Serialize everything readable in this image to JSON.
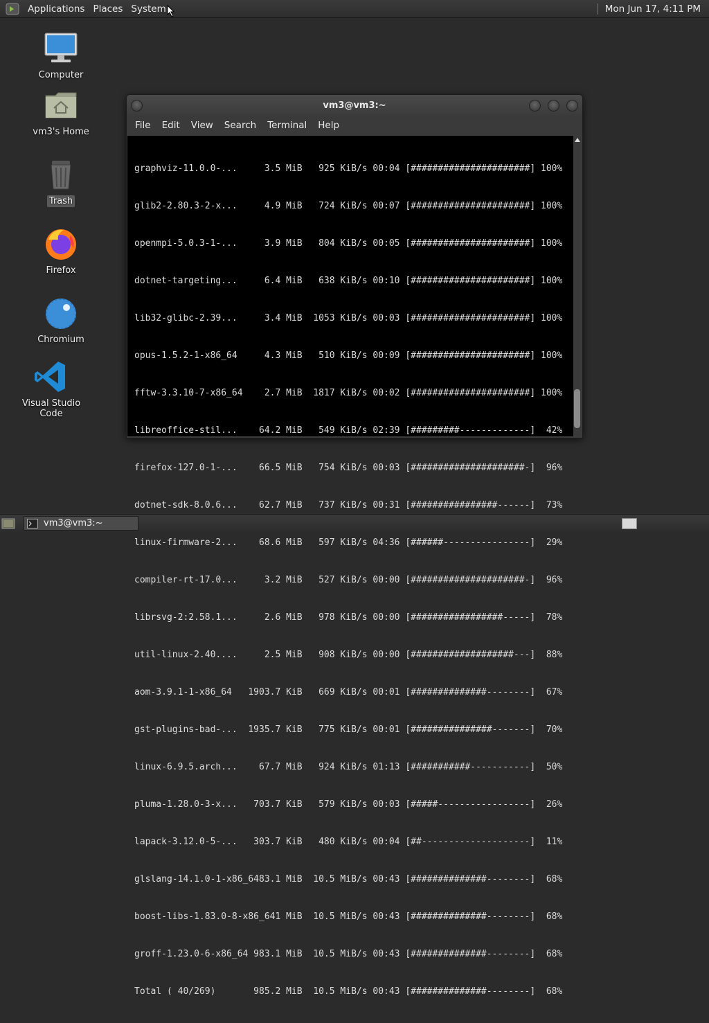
{
  "top_panel": {
    "menus": [
      "Applications",
      "Places",
      "System"
    ],
    "clock": "Mon Jun 17,  4:11 PM"
  },
  "desktop": {
    "icons": [
      {
        "label": "Computer",
        "icon": "computer-icon"
      },
      {
        "label": "vm3's Home",
        "icon": "home-folder-icon"
      },
      {
        "label": "Trash",
        "icon": "trash-icon"
      },
      {
        "label": "Firefox",
        "icon": "firefox-icon"
      },
      {
        "label": "Chromium",
        "icon": "chromium-icon"
      },
      {
        "label": "Visual Studio Code",
        "icon": "vscode-icon"
      }
    ]
  },
  "window": {
    "title": "vm3@vm3:~",
    "menu": [
      "File",
      "Edit",
      "View",
      "Search",
      "Terminal",
      "Help"
    ],
    "lines": [
      "graphviz-11.0.0-...     3.5 MiB   925 KiB/s 00:04 [######################] 100%",
      "glib2-2.80.3-2-x...     4.9 MiB   724 KiB/s 00:07 [######################] 100%",
      "openmpi-5.0.3-1-...     3.9 MiB   804 KiB/s 00:05 [######################] 100%",
      "dotnet-targeting...     6.4 MiB   638 KiB/s 00:10 [######################] 100%",
      "lib32-glibc-2.39...     3.4 MiB  1053 KiB/s 00:03 [######################] 100%",
      "opus-1.5.2-1-x86_64     4.3 MiB   510 KiB/s 00:09 [######################] 100%",
      "fftw-3.3.10-7-x86_64    2.7 MiB  1817 KiB/s 00:02 [######################] 100%",
      "libreoffice-stil...    64.2 MiB   549 KiB/s 02:39 [#########-------------]  42%",
      "firefox-127.0-1-...    66.5 MiB   754 KiB/s 00:03 [#####################-]  96%",
      "dotnet-sdk-8.0.6...    62.7 MiB   737 KiB/s 00:31 [################------]  73%",
      "linux-firmware-2...    68.6 MiB   597 KiB/s 04:36 [######----------------]  29%",
      "compiler-rt-17.0...     3.2 MiB   527 KiB/s 00:00 [#####################-]  96%",
      "librsvg-2:2.58.1...     2.6 MiB   978 KiB/s 00:00 [#################-----]  78%",
      "util-linux-2.40....     2.5 MiB   908 KiB/s 00:00 [###################---]  88%",
      "aom-3.9.1-1-x86_64   1903.7 KiB   669 KiB/s 00:01 [##############--------]  67%",
      "gst-plugins-bad-...  1935.7 KiB   775 KiB/s 00:01 [###############-------]  70%",
      "linux-6.9.5.arch...    67.7 MiB   924 KiB/s 01:13 [###########-----------]  50%",
      "pluma-1.28.0-3-x...   703.7 KiB   579 KiB/s 00:03 [#####-----------------]  26%",
      "lapack-3.12.0-5-...   303.7 KiB   480 KiB/s 00:04 [##--------------------]  11%",
      "glslang-14.1.0-1-x86_6483.1 MiB  10.5 MiB/s 00:43 [##############--------]  68%",
      "boost-libs-1.83.0-8-x86_641 MiB  10.5 MiB/s 00:43 [##############--------]  68%",
      "groff-1.23.0-6-x86_64 983.1 MiB  10.5 MiB/s 00:43 [##############--------]  68%",
      "Total ( 40/269)       985.2 MiB  10.5 MiB/s 00:43 [##############--------]  68%"
    ]
  },
  "taskbar": {
    "task_label": "vm3@vm3:~"
  },
  "colors": {
    "panel": "#333333",
    "desktop": "#2b2b2b",
    "terminal_bg": "#000000",
    "terminal_fg": "#dcdcdc"
  }
}
